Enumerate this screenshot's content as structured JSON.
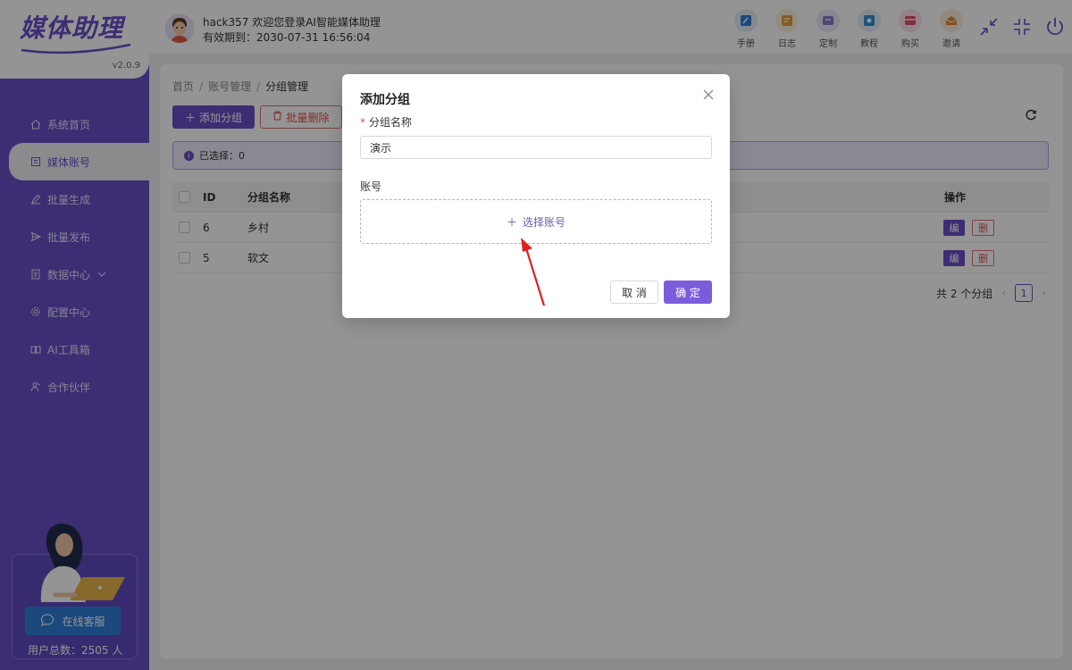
{
  "app": {
    "logo_text": "媒体助理",
    "version": "v2.0.9"
  },
  "header": {
    "user_line1": "hack357 欢迎您登录AI智能媒体助理",
    "user_line2": "有效期到：2030-07-31 16:56:04",
    "tools": [
      {
        "label": "手册",
        "icon": "manual-icon",
        "bg": "#e3eef9",
        "fg": "#2f7fd8"
      },
      {
        "label": "日志",
        "icon": "log-icon",
        "bg": "#fbf1dd",
        "fg": "#e0a23c"
      },
      {
        "label": "定制",
        "icon": "custom-icon",
        "bg": "#ebe7f8",
        "fg": "#8a79c8"
      },
      {
        "label": "教程",
        "icon": "tutorial-icon",
        "bg": "#e3eef9",
        "fg": "#2f8fd8"
      },
      {
        "label": "购买",
        "icon": "purchase-icon",
        "bg": "#fbe3ea",
        "fg": "#e0506a"
      },
      {
        "label": "邀请",
        "icon": "invite-icon",
        "bg": "#fbeedd",
        "fg": "#e08a3c"
      }
    ]
  },
  "sidebar": {
    "items": [
      {
        "label": "系统首页",
        "icon": "home-icon"
      },
      {
        "label": "媒体账号",
        "icon": "account-icon"
      },
      {
        "label": "批量生成",
        "icon": "edit-icon"
      },
      {
        "label": "批量发布",
        "icon": "send-icon"
      },
      {
        "label": "数据中心",
        "icon": "data-icon"
      },
      {
        "label": "配置中心",
        "icon": "settings-icon"
      },
      {
        "label": "AI工具箱",
        "icon": "toolbox-icon"
      },
      {
        "label": "合作伙伴",
        "icon": "partner-icon"
      }
    ],
    "chat_label": "在线客服",
    "user_total": "用户总数：2505 人"
  },
  "breadcrumb": {
    "home": "首页",
    "parent": "账号管理",
    "current": "分组管理"
  },
  "toolbar": {
    "add_label": "添加分组",
    "delete_label": "批量删除"
  },
  "selection": {
    "text": "已选择：0"
  },
  "table": {
    "headers": {
      "id": "ID",
      "name": "分组名称",
      "op": "操作"
    },
    "rows": [
      {
        "id": "6",
        "name": "乡村",
        "edit": "编",
        "del": "删"
      },
      {
        "id": "5",
        "name": "软文",
        "edit": "编",
        "del": "删"
      }
    ]
  },
  "pagination": {
    "total": "共 2 个分组",
    "page": "1"
  },
  "dialog": {
    "title": "添加分组",
    "name_label": "分组名称",
    "required_mark": "*",
    "name_value": "演示",
    "account_label": "账号",
    "select_account": "选择账号",
    "cancel": "取 消",
    "ok": "确 定"
  },
  "colors": {
    "brand": "#6a4ec6",
    "danger": "#e05050",
    "chat": "#2f7fd8"
  }
}
